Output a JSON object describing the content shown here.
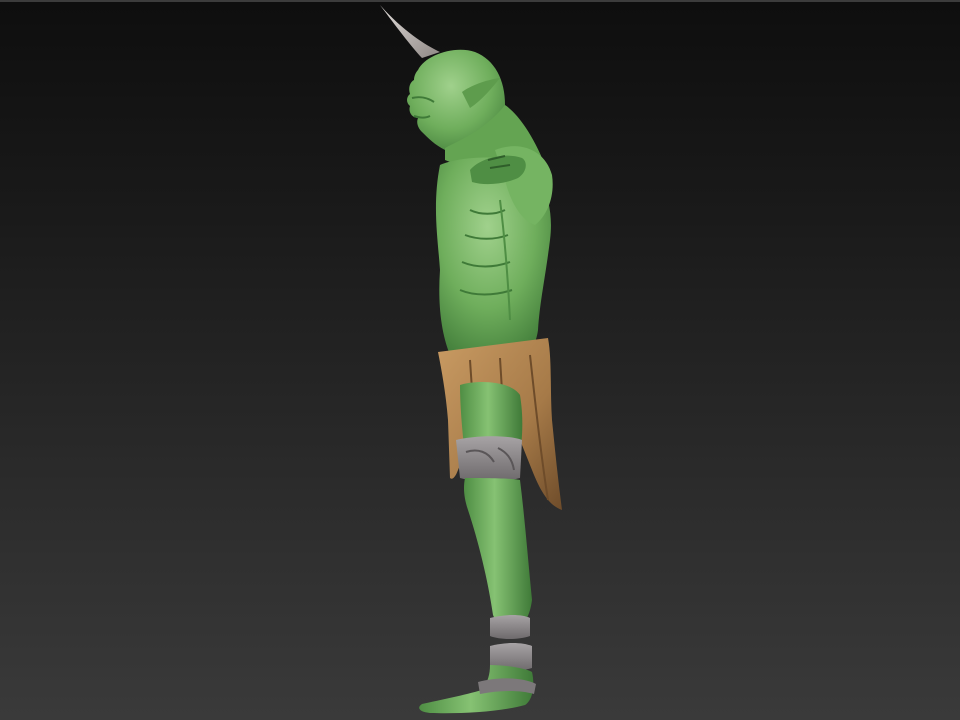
{
  "viewport": {
    "background_top": "#0e0e0e",
    "background_bottom": "#3a3a3a"
  },
  "model": {
    "subject": "green-orc-sculpt",
    "view": "side-profile",
    "colors": {
      "skin": "#6fae5c",
      "skin_shadow": "#3f7a38",
      "skin_highlight": "#9ad089",
      "horn": "#bdb7b4",
      "loincloth": "#b78b55",
      "loincloth_shadow": "#7a5630",
      "straps": "#8e8a8c"
    }
  }
}
